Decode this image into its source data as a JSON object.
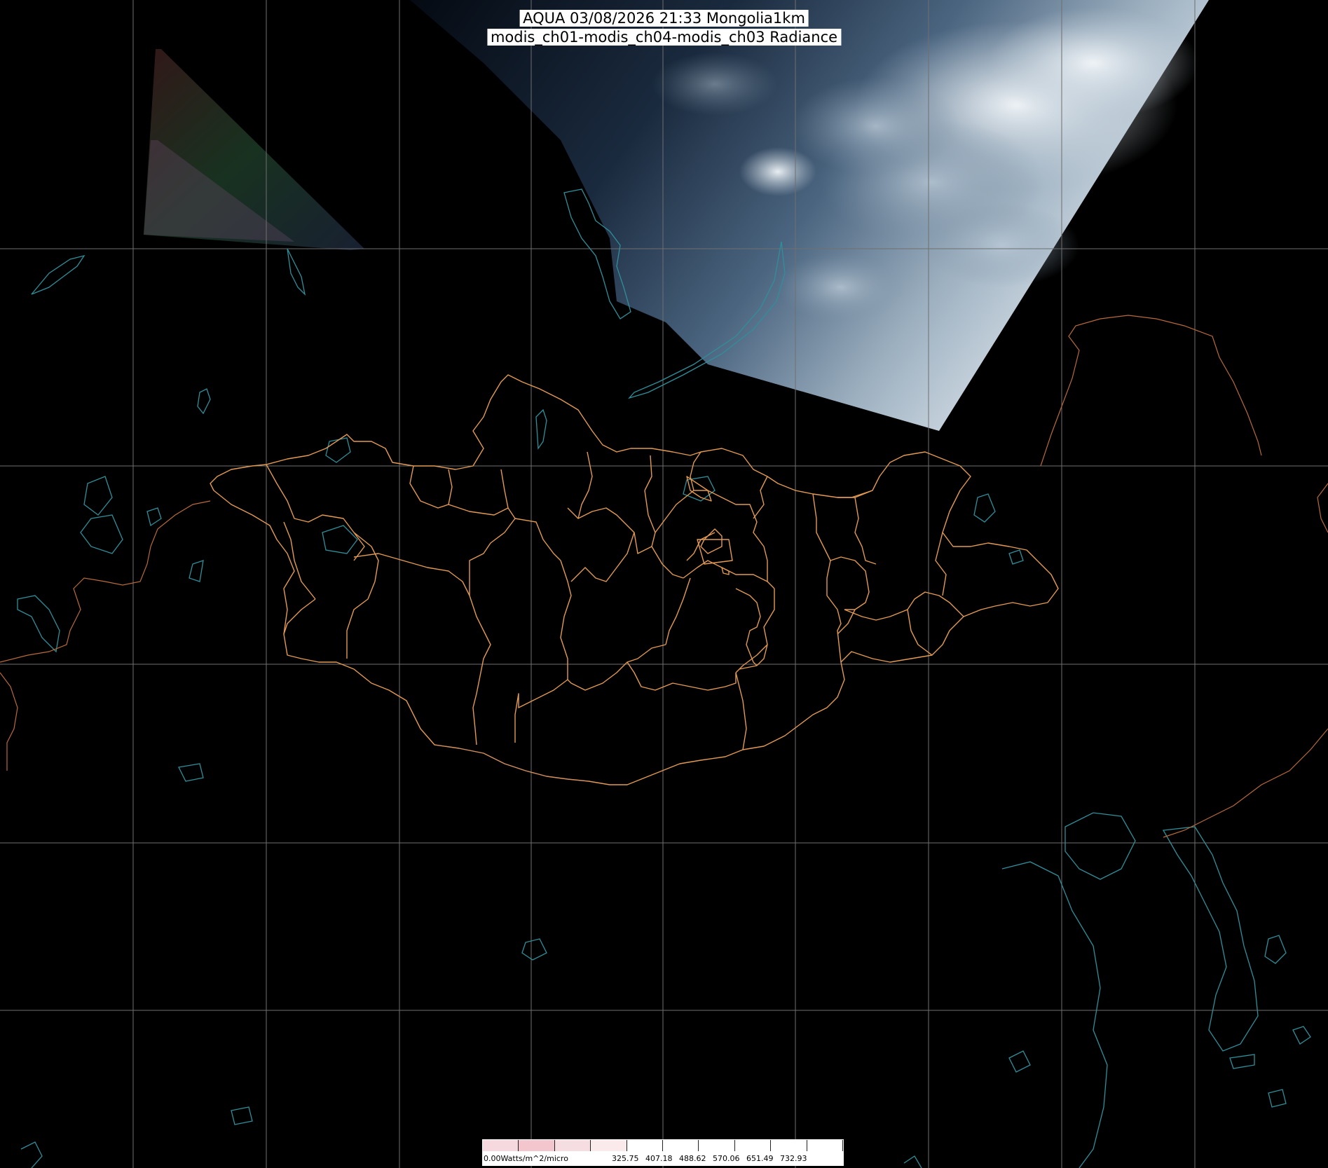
{
  "header": {
    "title_line1": "AQUA 03/08/2026 21:33 Mongolia1km",
    "title_line2": "modis_ch01-modis_ch04-modis_ch03 Radiance"
  },
  "colorbar": {
    "labels": [
      "0.00Watts/m^2/micro",
      "325.75",
      "407.18",
      "488.62",
      "570.06",
      "651.49",
      "732.93"
    ],
    "colors": [
      "#f6d9de",
      "#f2c6cc",
      "#f6dde2",
      "#fbeaec",
      "#ffffff",
      "#ffffff",
      "#ffffff",
      "#ffffff",
      "#ffffff",
      "#ffffff"
    ]
  },
  "map_style": {
    "background": "#000000",
    "graticule_color": "#6f6f6f",
    "admin_border_color": "#e39a52",
    "national_border_color": "#b86a3a",
    "coastline_color": "#2f8f9a",
    "imagery_colors": [
      "#0b1420",
      "#1f3550",
      "#4a6682",
      "#9fb3c2",
      "#e8eef2"
    ]
  }
}
